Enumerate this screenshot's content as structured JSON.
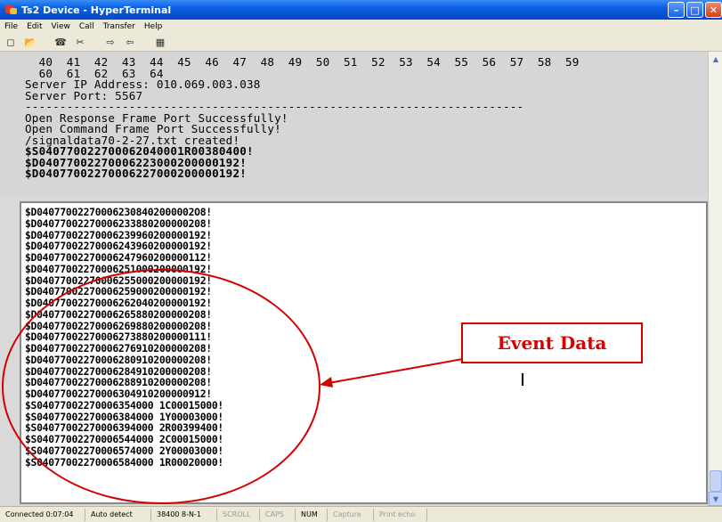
{
  "window": {
    "title": "Ts2 Device - HyperTerminal"
  },
  "menu": [
    "File",
    "Edit",
    "View",
    "Call",
    "Transfer",
    "Help"
  ],
  "toolbar": {
    "icons": [
      "new-icon",
      "open-icon",
      "phone-icon",
      "disconnect-icon",
      "send-icon",
      "receive-icon",
      "properties-icon"
    ]
  },
  "upper_lines": [
    "  40  41  42  43  44  45  46  47  48  49  50  51  52  53  54  55  56  57  58  59",
    "  60  61  62  63  64",
    "Server IP Address: 010.069.003.038",
    "Server Port: 5567",
    "------------------------------------------------------------------------",
    "Open Response Frame Port Successfully!",
    "Open Command Frame Port Successfully!",
    "/signaldata70-2-27.txt created!",
    "$S040770022700062040001R00380400!",
    "$D0407700227000622300020000019​2!",
    "$D04077002270006227000200000192!"
  ],
  "lower_lines": [
    "$D040770022700062308402000002O8!",
    "$D04077002270006233880200000208!",
    "$D04077002270006239960200000192!",
    "$D04077002270006243960200000192!",
    "$D04077002270006247960200000112!",
    "$D04077002270006251000200000192!",
    "$D04077002270006255000200000192!",
    "$D04077002270006259000200000192!",
    "$D04077002270006262040200000192!",
    "$D04077002270006265880200000208!",
    "$D04077002270006269880200000208!",
    "$D04077002270006273880200000111!",
    "$D04077002270006276910200000208!",
    "$D04077002270006280910200000208!",
    "$D04077002270006284910200000208!",
    "$D04077002270006288910200000208!",
    "$D04077002270006304910200000912!",
    "$S04077002270006354000 1C00015000!",
    "$S04077002270006384000 1Y00003000!",
    "$S04077002270006394000 2R00399400!",
    "$S04077002270006544000 2C00015000!",
    "$S04077002270006574000 2Y00003000!",
    "$S04077002270006584000 1R00020000!"
  ],
  "annotation": {
    "label": "Event Data",
    "color": "#d40000"
  },
  "status": {
    "connected": "Connected 0:07:04",
    "detect": "Auto detect",
    "port": "38400 8-N-1",
    "scroll": "SCROLL",
    "caps": "CAPS",
    "num": "NUM",
    "capture": "Capture",
    "print": "Print echo"
  }
}
